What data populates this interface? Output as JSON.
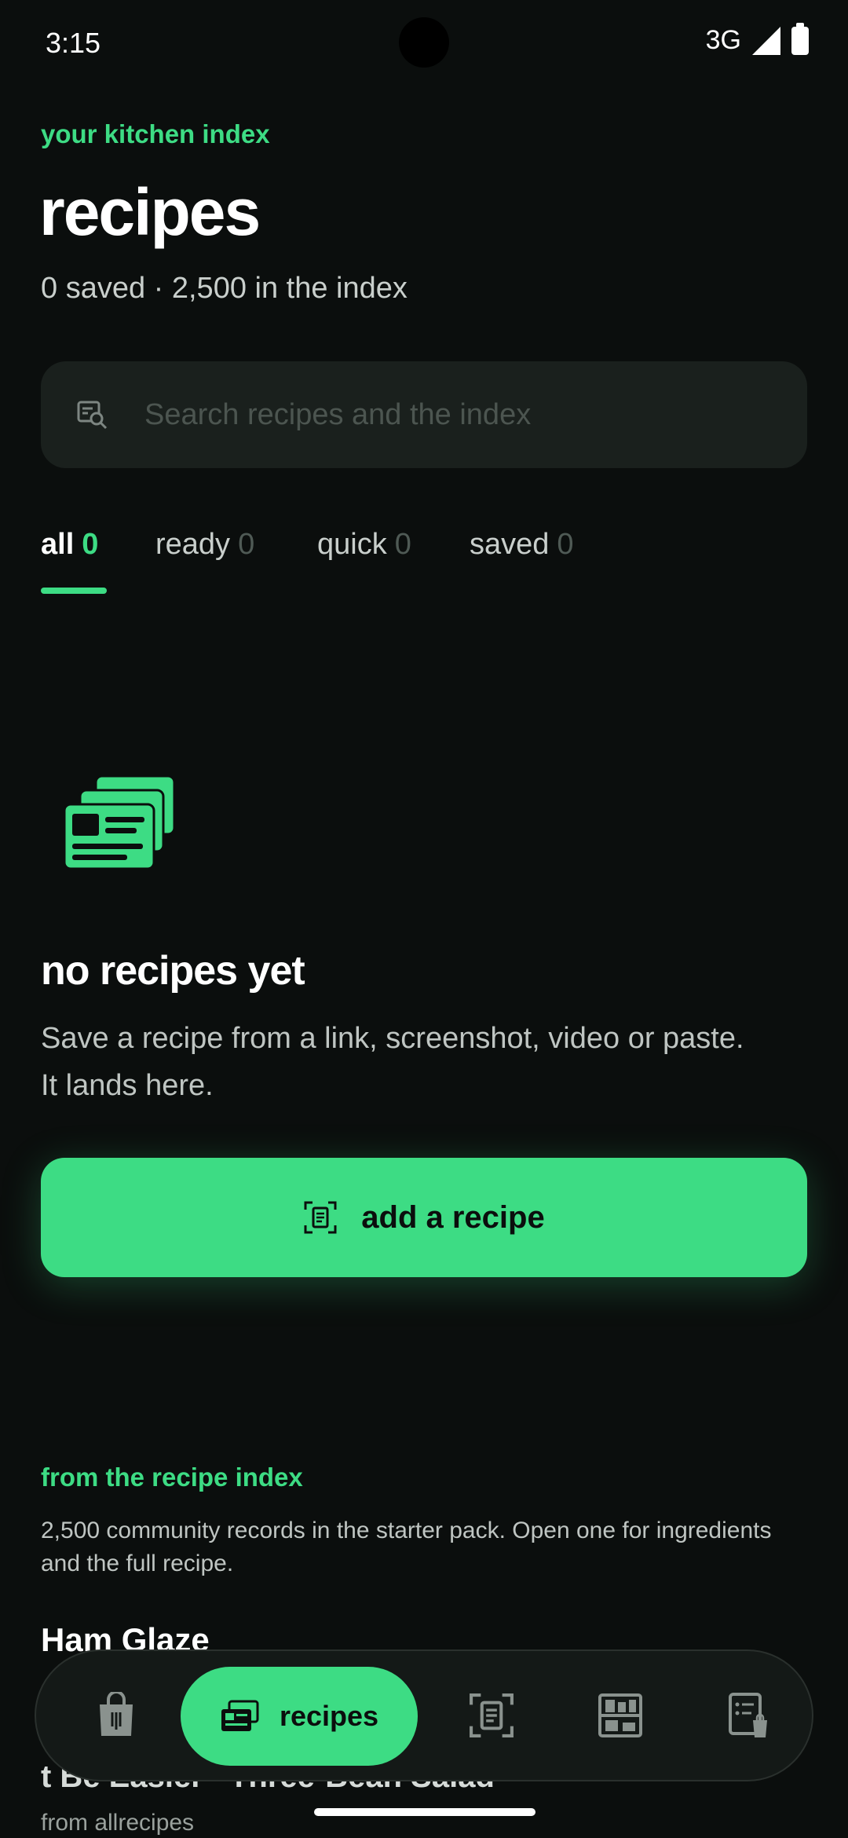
{
  "status_bar": {
    "time": "3:15",
    "network": "3G"
  },
  "header": {
    "eyebrow": "your kitchen index",
    "title": "recipes",
    "subtitle": "0 saved · 2,500 in the index"
  },
  "search": {
    "placeholder": "Search recipes and the index"
  },
  "tabs": [
    {
      "label": "all",
      "count": "0",
      "active": true
    },
    {
      "label": "ready",
      "count": "0",
      "active": false
    },
    {
      "label": "quick",
      "count": "0",
      "active": false
    },
    {
      "label": "saved",
      "count": "0",
      "active": false
    }
  ],
  "empty_state": {
    "icon": "recipe-cards-icon",
    "title": "no recipes yet",
    "text": "Save a recipe from a link, screenshot, video or paste. It lands here.",
    "button_label": "add a recipe",
    "button_icon": "scan-recipe-icon"
  },
  "recipe_index": {
    "eyebrow": "from the recipe index",
    "description": "2,500 community records in the starter pack. Open one for ingredients and the full recipe.",
    "items": [
      "Ham Glaze",
      "t Be Easier",
      "Three-Bean Salad"
    ],
    "source": "from allrecipes"
  },
  "bottom_nav": {
    "items": [
      {
        "icon": "grocery-bag-icon"
      },
      {
        "icon": "recipe-cards-icon",
        "label": "recipes",
        "active": true
      },
      {
        "icon": "scan-recipe-icon"
      },
      {
        "icon": "pantry-icon"
      },
      {
        "icon": "shopping-list-icon"
      }
    ]
  },
  "colors": {
    "accent": "#3ddc84",
    "background": "#0b0e0d",
    "surface": "#1a201d"
  }
}
